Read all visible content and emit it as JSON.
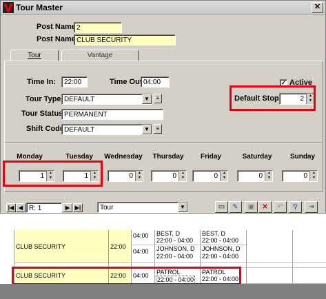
{
  "window": {
    "title": "Tour Master",
    "close_glyph": "✕"
  },
  "header": {
    "post_name_label": "Post Name:",
    "post_id": "2",
    "post_name2_label": "Post Name:",
    "post_name": "CLUB SECURITY"
  },
  "tabs": [
    {
      "label": "Tour",
      "active": true
    },
    {
      "label": "Vantage",
      "active": false
    }
  ],
  "tour": {
    "time_in_label": "Time In:",
    "time_in": "22:00",
    "time_out_label": "Time Out:",
    "time_out": "04:00",
    "active_label": "Active",
    "active_checked": true,
    "tour_type_label": "Tour Type:",
    "tour_type": "DEFAULT",
    "tour_status_label": "Tour Status:",
    "tour_status": "PERMANENT",
    "shift_code_label": "Shift Code:",
    "shift_code": "DEFAULT",
    "default_stops_label": "Default Stops:",
    "default_stops": "2"
  },
  "days": [
    {
      "label": "Monday",
      "value": "1"
    },
    {
      "label": "Tuesday",
      "value": "1"
    },
    {
      "label": "Wednesday",
      "value": "0"
    },
    {
      "label": "Thursday",
      "value": "0"
    },
    {
      "label": "Friday",
      "value": "0"
    },
    {
      "label": "Saturday",
      "value": "0"
    },
    {
      "label": "Sunday",
      "value": "0"
    }
  ],
  "toolbar": {
    "record_label": "R: 1",
    "view_select": "Tour"
  },
  "grid": {
    "rows": [
      {
        "name": "CLUB SECURITY",
        "start": "22:00",
        "end1": "04:00",
        "end2": "04:00",
        "assign_a1": "BEST, D",
        "assign_a1_time": "22:00 - 04:00",
        "assign_a2": "JOHNSON, D",
        "assign_a2_time": "22:00 - 04:00",
        "assign_b1": "BEST, D",
        "assign_b1_time": "22:00 - 04:00",
        "assign_b2": "JOHNSON, D",
        "assign_b2_time": "22:00 - 04:00"
      },
      {
        "name": "CLUB SECURITY",
        "start": "22:00",
        "end": "04:00",
        "assign_a": "PATROL",
        "assign_a_time": "22:00 - 04:00",
        "assign_b": "PATROL",
        "assign_b_time": "22:00 - 04:00"
      }
    ]
  },
  "colors": {
    "highlight": "#e8000d",
    "yellow_field": "#ffffc0",
    "dialog_bg": "#d4d0c8"
  }
}
